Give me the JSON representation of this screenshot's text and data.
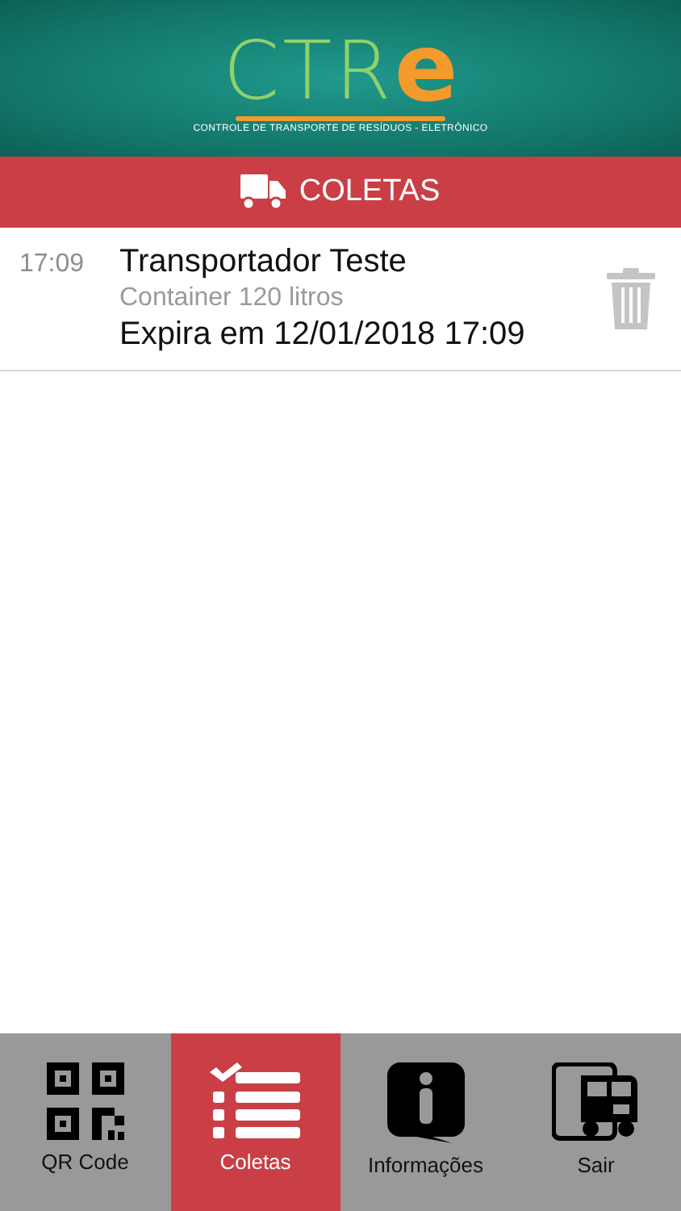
{
  "logo": {
    "letters": "CTR",
    "accent": "e",
    "subtitle": "CONTROLE DE TRANSPORTE DE RESÍDUOS - ELETRÔNICO"
  },
  "section": {
    "title": "COLETAS"
  },
  "items": [
    {
      "time": "17:09",
      "title": "Transportador Teste",
      "subtitle": "Container 120 litros",
      "expires": "Expira em 12/01/2018 17:09"
    }
  ],
  "tabs": [
    {
      "kind": "qr",
      "label": "QR Code",
      "selected": false
    },
    {
      "kind": "list",
      "label": "Coletas",
      "selected": true
    },
    {
      "kind": "info",
      "label": "Informações",
      "selected": false
    },
    {
      "kind": "exit",
      "label": "Sair",
      "selected": false
    }
  ]
}
